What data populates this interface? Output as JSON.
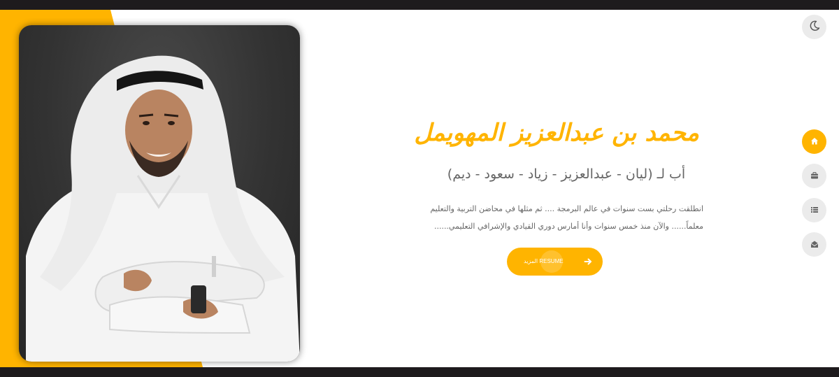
{
  "colors": {
    "accent": "#ffb400",
    "dark_bar": "#1e1b1d",
    "text_muted": "#666666",
    "button_bg": "#ebebeb",
    "icon_dark": "#666666"
  },
  "header": {
    "theme_toggle_icon": "moon-icon"
  },
  "nav": {
    "items": [
      {
        "icon": "home-icon",
        "active": true
      },
      {
        "icon": "briefcase-icon",
        "active": false
      },
      {
        "icon": "list-icon",
        "active": false
      },
      {
        "icon": "envelope-open-icon",
        "active": false
      }
    ]
  },
  "hero": {
    "name": "محمد بن عبدالعزيز المهويمل",
    "subtitle": "أب لـ (ليان - عبدالعزيز - زياد - سعود - ديم)",
    "bio_line_1": "انطلقت رحلتي بست سنوات في عالم البرمجة .... ثم مثلها في محاضن التربية والتعليم",
    "bio_line_2": "معلماً...... والآن منذ خمس سنوات وأنا أمارس دوري القيادي والإشرافي التعليمي......",
    "cta_label": "المزيد RESUME",
    "cta_icon": "arrow-right-icon"
  },
  "photo": {
    "subject": "portrait-photo"
  }
}
